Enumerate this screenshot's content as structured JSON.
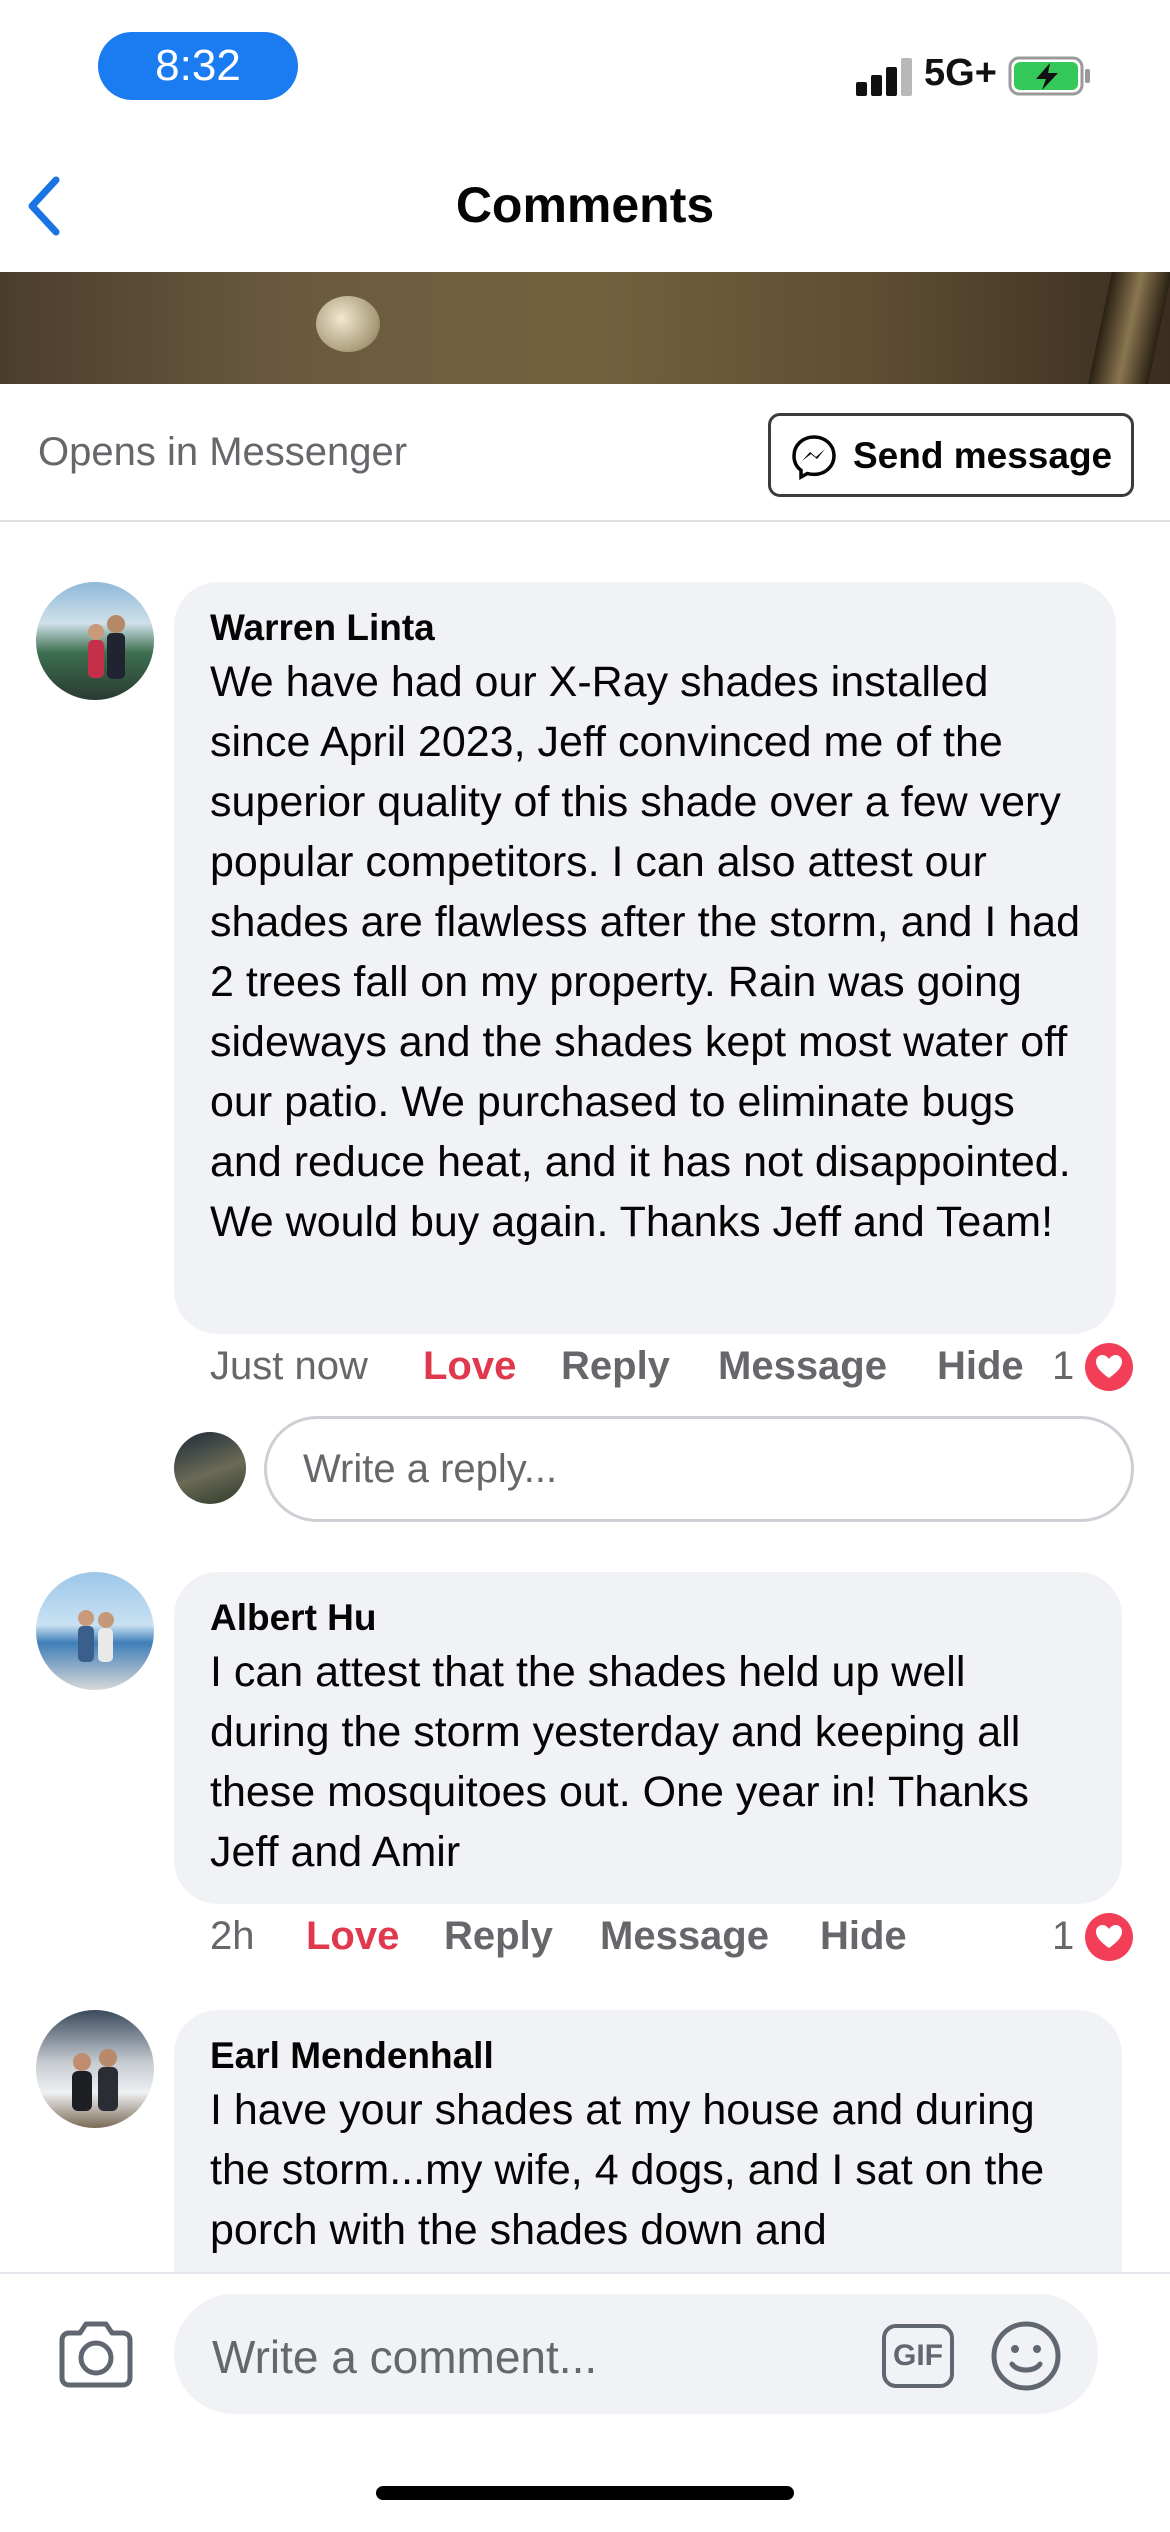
{
  "status_bar": {
    "time": "8:32",
    "network": "5G+",
    "icons": [
      "signal-icon",
      "battery-charging-icon"
    ]
  },
  "header": {
    "title": "Comments",
    "back_icon": "chevron-left-icon"
  },
  "messenger_bar": {
    "label": "Opens in Messenger",
    "button_label": "Send message",
    "button_icon": "messenger-icon"
  },
  "comments": [
    {
      "author": "Warren Linta",
      "text": "We have had our X-Ray shades installed since April 2023, Jeff convinced me of the superior quality of this shade over a few very popular competitors. I can also attest our shades are flawless after the storm, and I had 2 trees fall on my property. Rain was going sideways and the shades kept most water off our patio. We purchased to eliminate bugs and reduce heat, and it has not disappointed. We would buy again. Thanks Jeff and Team!",
      "time": "Just now",
      "actions": [
        "Love",
        "Reply",
        "Message",
        "Hide"
      ],
      "reaction_count": "1",
      "reaction_icon": "heart-icon"
    },
    {
      "author": "Albert Hu",
      "text": "I can attest that the shades held up well during the storm yesterday and keeping all these mosquitoes out. One year in! Thanks Jeff and Amir",
      "time": "2h",
      "actions": [
        "Love",
        "Reply",
        "Message",
        "Hide"
      ],
      "reaction_count": "1",
      "reaction_icon": "heart-icon"
    },
    {
      "author": "Earl Mendenhall",
      "text": "I have your shades at my house and during the storm...my wife, 4 dogs, and I sat on the porch with the shades down and"
    }
  ],
  "reply_box": {
    "placeholder": "Write a reply..."
  },
  "composer": {
    "placeholder": "Write a comment...",
    "gif_label": "GIF",
    "icons": [
      "camera-icon",
      "gif-icon",
      "emoji-icon"
    ]
  },
  "colors": {
    "accent": "#1b7cf2",
    "love": "#e0394d",
    "bubble": "#f0f2f5",
    "secondary_text": "#65676b"
  }
}
